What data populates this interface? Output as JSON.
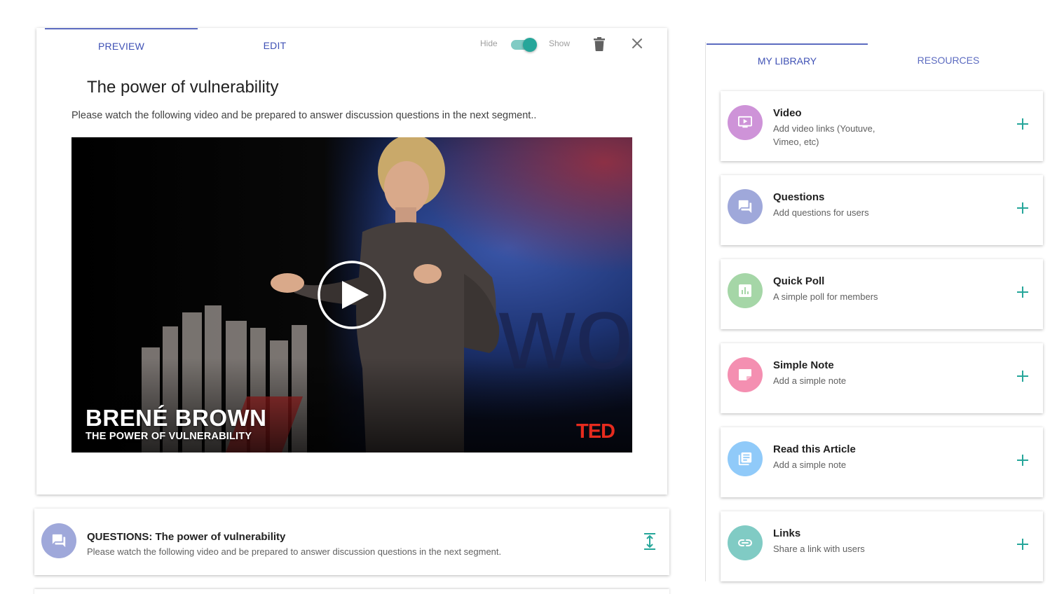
{
  "preview_card": {
    "tabs": [
      {
        "label": "PREVIEW",
        "active": true
      },
      {
        "label": "EDIT",
        "active": false
      }
    ],
    "visibility": {
      "hide_label": "Hide",
      "show_label": "Show",
      "state": "show"
    },
    "title": "The power of vulnerability",
    "description": "Please watch the following video and be prepared to answer discussion questions in the next segment..",
    "video": {
      "speaker": "BRENÉ BROWN",
      "talk_title": "THE POWER OF VULNERABILITY",
      "logo": "TED",
      "play_icon": "play-icon"
    }
  },
  "questions_strip": {
    "icon": "chat-icon",
    "title": "QUESTIONS: The power of vulnerability",
    "description": "Please watch the following video and be prepared to answer discussion questions in the next segment.",
    "expand_icon": "expand-icon"
  },
  "library": {
    "tabs": [
      {
        "label": "MY LIBRARY",
        "active": true
      },
      {
        "label": "RESOURCES",
        "active": false
      }
    ],
    "items": [
      {
        "title": "Video",
        "description": "Add video links (Youtuve, Vimeo, etc)",
        "icon": "video-screen-icon",
        "color": "#ce93d8"
      },
      {
        "title": "Questions",
        "description": "Add questions for users",
        "icon": "chat-icon",
        "color": "#9fa8da"
      },
      {
        "title": "Quick Poll",
        "description": "A simple poll for members",
        "icon": "poll-icon",
        "color": "#a5d6a7"
      },
      {
        "title": "Simple Note",
        "description": "Add a simple note",
        "icon": "note-icon",
        "color": "#f48fb1"
      },
      {
        "title": "Read this Article",
        "description": "Add a simple note",
        "icon": "article-icon",
        "color": "#90caf9"
      },
      {
        "title": "Links",
        "description": "Share a link with users",
        "icon": "link-icon",
        "color": "#80cbc4"
      }
    ]
  },
  "colors": {
    "accent": "#3f51b5",
    "teal": "#26a69a",
    "plus": "#26a69a"
  }
}
